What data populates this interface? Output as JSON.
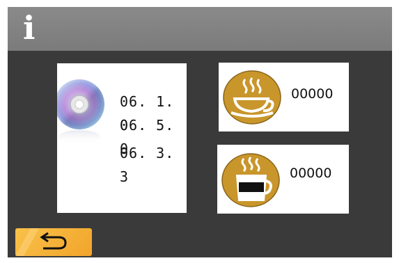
{
  "header": {
    "info_glyph": "i",
    "icon": "info-icon"
  },
  "firmware": {
    "icon": "cd-icon",
    "versions": [
      "06. 1. 0",
      "06. 5. 0",
      "06. 3. 3"
    ]
  },
  "counters": [
    {
      "icon": "coffee-cup-icon",
      "value": "00000"
    },
    {
      "icon": "espresso-glass-icon",
      "value": "00000"
    }
  ],
  "footer": {
    "back_icon": "return-arrow-icon"
  },
  "colors": {
    "header": "#858585",
    "background": "#3a3a3a",
    "button": "#f5b236",
    "icon_badge": "#c9962b"
  }
}
